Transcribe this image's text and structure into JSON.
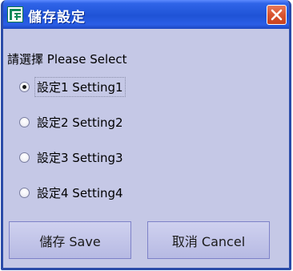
{
  "window": {
    "title": "儲存設定",
    "icon": "app-icon",
    "close_icon": "close-icon"
  },
  "prompt": "請選擇 Please Select",
  "options": [
    {
      "label": "設定1 Setting1",
      "checked": true
    },
    {
      "label": "設定2 Setting2",
      "checked": false
    },
    {
      "label": "設定3 Setting3",
      "checked": false
    },
    {
      "label": "設定4 Setting4",
      "checked": false
    }
  ],
  "buttons": {
    "save_label": "儲存 Save",
    "cancel_label": "取消 Cancel"
  },
  "colors": {
    "titlebar": "#2a5ee6",
    "background": "#c5c8e6",
    "close": "#d9542f",
    "button": "#b7bae3"
  }
}
